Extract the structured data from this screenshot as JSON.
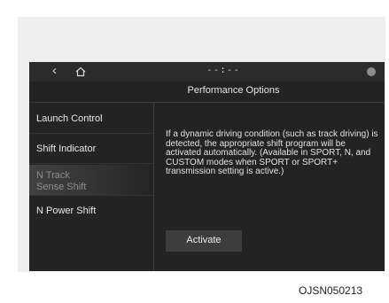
{
  "header": {
    "back_icon": "chevron-left",
    "home_icon": "home",
    "status_glyph": "--:--",
    "corner_icon": "settings"
  },
  "page": {
    "title": "Performance Options"
  },
  "sidebar": {
    "items": [
      {
        "label": "Launch Control"
      },
      {
        "label": "Shift Indicator"
      },
      {
        "label": "N Track Sense Shift",
        "selected": true
      },
      {
        "label": "N Power Shift"
      }
    ]
  },
  "content": {
    "description": "If a dynamic driving condition (such as track driving) is detected, the appropriate shift program will be activated automatically. (Available in SPORT, N, and CUSTOM modes when SPORT or SPORT+ transmission setting is active.)",
    "activate_label": "Activate"
  },
  "figure_code": "OJSN050213"
}
